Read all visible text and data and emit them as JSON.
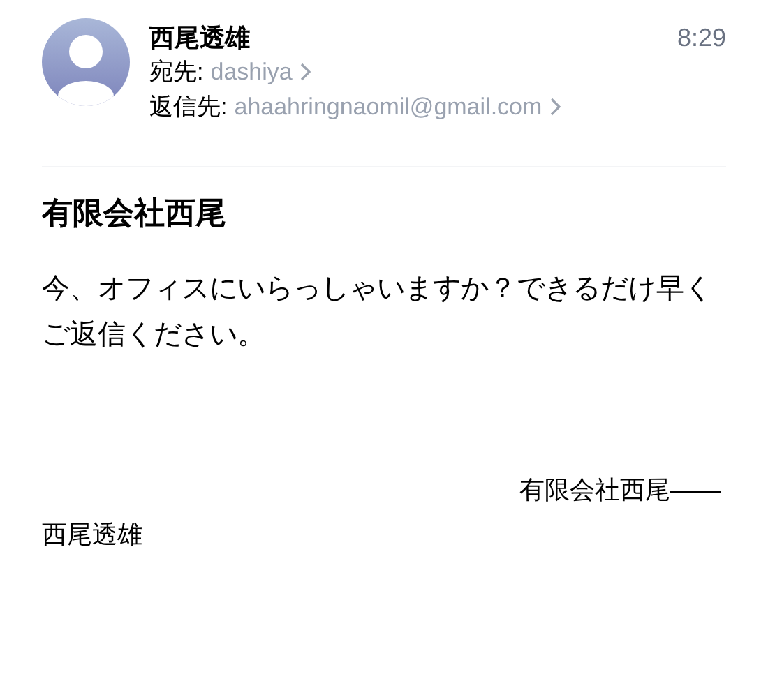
{
  "header": {
    "sender": "西尾透雄",
    "time": "8:29",
    "fields": [
      {
        "label": "宛先:",
        "value": "dashiya"
      },
      {
        "label": "返信先:",
        "value": "ahaahringnaomil@gmail.com"
      }
    ]
  },
  "subject": "有限会社西尾",
  "body": "今、オフィスにいらっしゃいますか？できるだけ早くご返信ください。",
  "signature": [
    "有限会社西尾——",
    "西尾透雄"
  ]
}
